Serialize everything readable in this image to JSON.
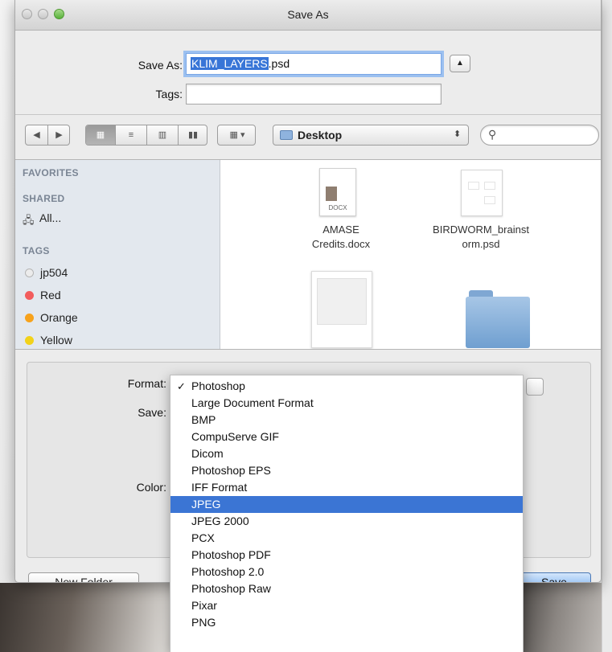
{
  "window": {
    "title": "Save As"
  },
  "save_as": {
    "label": "Save As:",
    "filename_selected": "KLIM_LAYERS",
    "filename_ext": ".psd",
    "tags_label": "Tags:",
    "tags_value": ""
  },
  "toolbar": {
    "location": "Desktop",
    "search_placeholder": ""
  },
  "sidebar": {
    "sections": {
      "favorites": "FAVORITES",
      "shared": "SHARED",
      "tags": "TAGS"
    },
    "shared_items": [
      {
        "label": "All..."
      }
    ],
    "tag_items": [
      {
        "label": "jp504",
        "color": "#d5d5d5"
      },
      {
        "label": "Red",
        "color": "#f25c5c"
      },
      {
        "label": "Orange",
        "color": "#f7a21b"
      },
      {
        "label": "Yellow",
        "color": "#f2d21a"
      }
    ]
  },
  "files": [
    {
      "name": "AMASE Credits.docx",
      "line1": "AMASE",
      "line2": "Credits.docx",
      "icon_text": "DOCX"
    },
    {
      "name": "BIRDWORM_brainstorm.psd",
      "line1": "BIRDWORM_brainst",
      "line2": "orm.psd"
    },
    {
      "name": "",
      "line1": "",
      "line2": ""
    },
    {
      "name": "",
      "line1": "",
      "line2": ""
    }
  ],
  "options": {
    "format_label": "Format:",
    "save_label": "Save:",
    "color_label": "Color:"
  },
  "format_menu": {
    "selected": "JPEG",
    "items": [
      "Photoshop",
      "Large Document Format",
      "BMP",
      "CompuServe GIF",
      "Dicom",
      "Photoshop EPS",
      "IFF Format",
      "JPEG",
      "JPEG 2000",
      "PCX",
      "Photoshop PDF",
      "Photoshop 2.0",
      "Photoshop Raw",
      "Pixar",
      "PNG"
    ],
    "checked": "Photoshop"
  },
  "buttons": {
    "new_folder": "New Folder",
    "save": "Save"
  },
  "colors": {
    "accent": "#3b75d4",
    "sidebar_bg": "#e3e8ee"
  }
}
